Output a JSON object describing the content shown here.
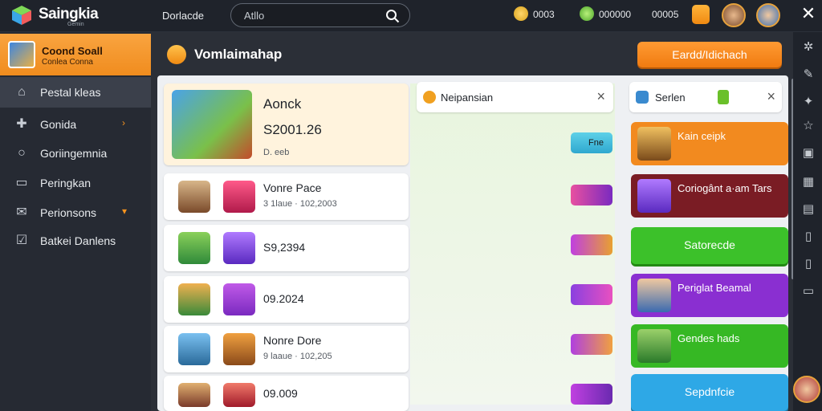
{
  "app": {
    "title": "Saingkia",
    "subtitle": "Gemin"
  },
  "topbar": {
    "link": "Dorlacde",
    "search_value": "Atllo",
    "stats": [
      "0003",
      "000000",
      "00005"
    ]
  },
  "sidebar": {
    "profile": {
      "name": "Coond Soall",
      "sub": "Conlea Conna"
    },
    "items": [
      {
        "label": "Pestal kleas",
        "icon": "home-icon"
      },
      {
        "label": "Gonida",
        "icon": "gamepad-icon"
      },
      {
        "label": "Goriingemnia",
        "icon": "search-icon"
      },
      {
        "label": "Peringkan",
        "icon": "card-icon"
      },
      {
        "label": "Perionsons",
        "icon": "mail-icon"
      },
      {
        "label": "Batkei Danlens",
        "icon": "checkbox-icon"
      }
    ]
  },
  "main": {
    "title": "Vomlaimahap",
    "top_button": "Eardd/Idichach",
    "featured": {
      "name": "Aonck",
      "price": "S2001.26",
      "meta": "D. eeb"
    },
    "rows": [
      {
        "name": "Vonre Pace",
        "meta": "3 1laue · 102,2003"
      },
      {
        "name": "S9,2394",
        "meta": ""
      },
      {
        "name": "09.2024",
        "meta": ""
      },
      {
        "name": "Nonre Dore",
        "meta": "9 laaue · 102,205"
      },
      {
        "name": "09.009",
        "meta": ""
      }
    ],
    "mid_panel": {
      "title": "Neipansian",
      "badge": "Fne"
    },
    "right_panel": {
      "title": "Serlen"
    },
    "cards": [
      {
        "title": "Kain ceipk",
        "color": "#f28a1f"
      },
      {
        "title": "Coriogânt a·am Tars",
        "color": "#7a1c24"
      },
      {
        "title": "Satorecde",
        "color": "#3cc12a"
      },
      {
        "title": "Periglat Beamal",
        "color": "#8a2fd1"
      },
      {
        "title": "Gendes hads",
        "color": "#36b824"
      },
      {
        "title": "Sepdnfcie",
        "color": "#2ea8e6"
      }
    ]
  },
  "colors": {
    "accent": "#f7931e",
    "topbar": "#1f232b",
    "sidebar": "#262a33"
  }
}
